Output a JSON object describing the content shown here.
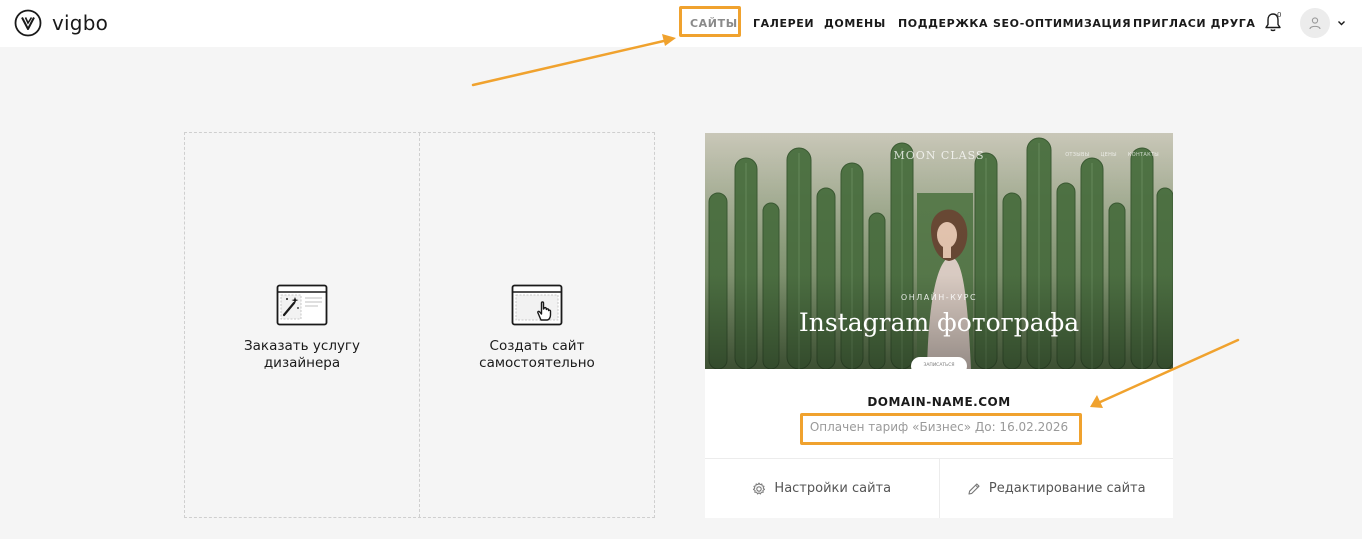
{
  "header": {
    "logo_text": "vigbo",
    "nav": [
      {
        "label": "Сайты",
        "active": true
      },
      {
        "label": "Галереи",
        "active": false
      },
      {
        "label": "Домены",
        "active": false
      },
      {
        "label": "Поддержка",
        "active": false
      },
      {
        "label": "SEO-оптимизация",
        "active": false
      },
      {
        "label": "Пригласи друга",
        "active": false
      }
    ],
    "notifications_count": "0",
    "icons": {
      "bell": "bell-icon",
      "avatar": "user-icon",
      "menu": "chevron-down-icon"
    }
  },
  "create": {
    "designer_label": "Заказать услугу дизайнера",
    "self_label": "Создать сайт самостоятельно",
    "icons": {
      "designer": "magic-wand-window-icon",
      "self": "hand-pointer-window-icon"
    }
  },
  "site": {
    "thumbnail": {
      "brand": "MOON CLASS",
      "menu": [
        "ОТЗЫВЫ",
        "ЦЕНЫ",
        "КОНТАКТЫ"
      ],
      "subtitle": "ОНЛАЙН-КУРС",
      "title": "Instagram фотографа",
      "button": "ЗАПИСАТЬСЯ"
    },
    "domain": "DOMAIN-NAME.COM",
    "tariff": "Оплачен тариф «Бизнес» До: 16.02.2026",
    "settings_label": "Настройки сайта",
    "edit_label": "Редактирование сайта",
    "icons": {
      "settings": "gear-icon",
      "edit": "pencil-icon"
    }
  },
  "annotations": {
    "highlight_color": "#f0a22e"
  },
  "colors": {
    "background": "#f5f5f5",
    "header": "#ffffff",
    "accent": "#f0a22e"
  }
}
